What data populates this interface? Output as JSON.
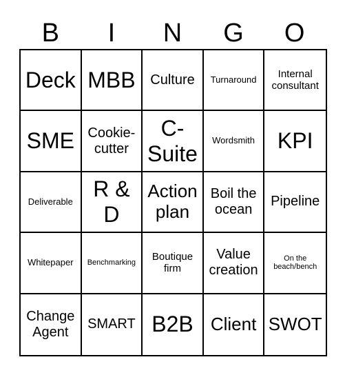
{
  "header": [
    "B",
    "I",
    "N",
    "G",
    "O"
  ],
  "cells": [
    {
      "text": "Deck",
      "size": "s-xl"
    },
    {
      "text": "MBB",
      "size": "s-xl"
    },
    {
      "text": "Culture",
      "size": "s-m"
    },
    {
      "text": "Turnaround",
      "size": "s-xs"
    },
    {
      "text": "Internal consultant",
      "size": "s-s"
    },
    {
      "text": "SME",
      "size": "s-xl"
    },
    {
      "text": "Cookie-cutter",
      "size": "s-m"
    },
    {
      "text": "C-Suite",
      "size": "s-xl"
    },
    {
      "text": "Wordsmith",
      "size": "s-xs"
    },
    {
      "text": "KPI",
      "size": "s-xl"
    },
    {
      "text": "Deliverable",
      "size": "s-xs"
    },
    {
      "text": "R & D",
      "size": "s-xl"
    },
    {
      "text": "Action plan",
      "size": "s-l"
    },
    {
      "text": "Boil the ocean",
      "size": "s-m"
    },
    {
      "text": "Pipeline",
      "size": "s-m"
    },
    {
      "text": "Whitepaper",
      "size": "s-xs"
    },
    {
      "text": "Benchmarking",
      "size": "s-xxs"
    },
    {
      "text": "Boutique firm",
      "size": "s-s"
    },
    {
      "text": "Value creation",
      "size": "s-m"
    },
    {
      "text": "On the beach/bench",
      "size": "s-xxs"
    },
    {
      "text": "Change Agent",
      "size": "s-m"
    },
    {
      "text": "SMART",
      "size": "s-m"
    },
    {
      "text": "B2B",
      "size": "s-xl"
    },
    {
      "text": "Client",
      "size": "s-l"
    },
    {
      "text": "SWOT",
      "size": "s-l"
    }
  ]
}
